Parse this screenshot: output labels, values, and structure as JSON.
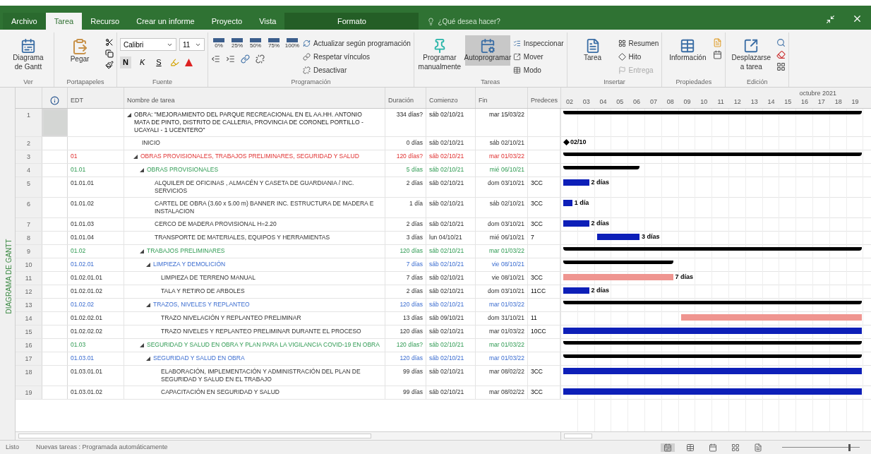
{
  "tabs": [
    {
      "label": "Archivo",
      "kind": "file",
      "selected": false
    },
    {
      "label": "Tarea",
      "kind": "normal",
      "selected": true
    },
    {
      "label": "Recurso",
      "kind": "normal",
      "selected": false
    },
    {
      "label": "Crear un informe",
      "kind": "normal",
      "selected": false
    },
    {
      "label": "Proyecto",
      "kind": "normal",
      "selected": false
    },
    {
      "label": "Vista",
      "kind": "normal",
      "selected": false
    },
    {
      "label": "Formato",
      "kind": "contextual",
      "selected": false
    }
  ],
  "search": {
    "placeholder": "¿Qué desea hacer?"
  },
  "ribbon": {
    "view": {
      "label": "Ver",
      "gantt": "Diagrama de Gantt"
    },
    "clipboard": {
      "label": "Portapapeles",
      "paste": "Pegar"
    },
    "font": {
      "label": "Fuente",
      "family": "Calibri",
      "size": "11",
      "styles": [
        "N",
        "K",
        "S"
      ]
    },
    "schedule": {
      "label": "Programación",
      "percents": [
        "0%",
        "25%",
        "50%",
        "75%",
        "100%"
      ],
      "actions": [
        {
          "label": "Actualizar según programación"
        },
        {
          "label": "Respetar vínculos"
        },
        {
          "label": "Desactivar"
        }
      ]
    },
    "tasks": {
      "label": "Tareas",
      "buttons": [
        {
          "label": "Programar manualmente",
          "selected": false
        },
        {
          "label": "Autoprogramar",
          "selected": true
        }
      ],
      "actions": [
        {
          "label": "Inspeccionar"
        },
        {
          "label": "Mover"
        },
        {
          "label": "Modo"
        }
      ]
    },
    "insert": {
      "label": "Insertar",
      "task": "Tarea",
      "actions": [
        {
          "label": "Resumen",
          "disabled": false
        },
        {
          "label": "Hito",
          "disabled": false
        },
        {
          "label": "Entrega",
          "disabled": true
        }
      ]
    },
    "properties": {
      "label": "Propiedades",
      "info": "Información"
    },
    "editing": {
      "label": "Edición",
      "scroll": "Desplazarse a tarea"
    }
  },
  "view_label": "DIAGRAMA DE GANTT",
  "columns": [
    "EDT",
    "Nombre de tarea",
    "Duración",
    "Comienzo",
    "Fin",
    "Predeces"
  ],
  "timeline": {
    "month": "octubre 2021",
    "days": [
      "02",
      "03",
      "04",
      "05",
      "06",
      "07",
      "08",
      "09",
      "10",
      "11",
      "12",
      "13",
      "14",
      "15",
      "16",
      "17",
      "18",
      "19"
    ]
  },
  "rows": [
    {
      "id": "1",
      "name": "OBRA: \"MEJORAMIENTO DEL PARQUE RECREACIONAL EN EL AA.HH. ANTONIO MATA DE PINTO, DISTRITO DE CALLERIA, PROVINCIA DE CORONEL PORTILLO - UCAYALI - 1 UCENTERO\"",
      "duration": "334 días?",
      "start": "sáb 02/10/21",
      "finish": "mar 15/03/22",
      "kind": "summary",
      "selected": true,
      "expanded": true,
      "children": [
        {
          "id": "2",
          "name": "INICIO",
          "duration": "0 días",
          "start": "sáb 02/10/21",
          "finish": "sáb 02/10/21",
          "kind": "milestone",
          "selected": false,
          "bar_label": "02/10"
        },
        {
          "id": "3",
          "code": "01",
          "name": "OBRAS PROVISIONALES, TRABAJOS PRELIMINARES, SEGURIDAD Y SALUD",
          "duration": "120 días?",
          "start": "sáb 02/10/21",
          "finish": "mar 01/03/22",
          "kind": "summary",
          "selected": false,
          "expanded": true,
          "children": [
            {
              "id": "4",
              "code": "01.01",
              "name": "OBRAS PROVISIONALES",
              "duration": "5 días",
              "start": "sáb 02/10/21",
              "finish": "mié 06/10/21",
              "kind": "summary",
              "selected": false,
              "expanded": true,
              "children": [
                {
                  "id": "5",
                  "code": "01.01.01",
                  "name": "ALQUILER DE OFICINAS , ALMACÉN Y CASETA DE GUARDIANIA / INC. SERVICIOS",
                  "duration": "2 días",
                  "start": "sáb 02/10/21",
                  "finish": "dom 03/10/21",
                  "pred": "3CC",
                  "kind": "task",
                  "critical": false,
                  "selected": false,
                  "bar_label": "2 días"
                },
                {
                  "id": "6",
                  "code": "01.01.02",
                  "name": "CARTEL DE OBRA (3.60 x 5.00 m) BANNER INC. ESTRUCTURA DE MADERA E INSTALACION",
                  "duration": "1 día",
                  "start": "sáb 02/10/21",
                  "finish": "sáb 02/10/21",
                  "pred": "3CC",
                  "kind": "task",
                  "critical": false,
                  "selected": false,
                  "bar_label": "1 día"
                },
                {
                  "id": "7",
                  "code": "01.01.03",
                  "name": "CERCO DE MADERA PROVISIONAL H=2.20",
                  "duration": "2 días",
                  "start": "sáb 02/10/21",
                  "finish": "dom 03/10/21",
                  "pred": "3CC",
                  "kind": "task",
                  "critical": false,
                  "selected": false,
                  "bar_label": "2 días"
                },
                {
                  "id": "8",
                  "code": "01.01.04",
                  "name": "TRANSPORTE DE MATERIALES, EQUIPOS Y HERRAMIENTAS",
                  "duration": "3 días",
                  "start": "lun 04/10/21",
                  "finish": "mié 06/10/21",
                  "pred": "7",
                  "kind": "task",
                  "critical": false,
                  "selected": false,
                  "bar_label": "3 días"
                }
              ]
            },
            {
              "id": "9",
              "code": "01.02",
              "name": "TRABAJOS PRELIMINARES",
              "duration": "120 días",
              "start": "sáb 02/10/21",
              "finish": "mar 01/03/22",
              "kind": "summary",
              "selected": false,
              "expanded": true,
              "children": [
                {
                  "id": "10",
                  "code": "01.02.01",
                  "name": "LIMPIEZA Y DEMOLICIÓN",
                  "duration": "7 días",
                  "start": "sáb 02/10/21",
                  "finish": "vie 08/10/21",
                  "kind": "summary",
                  "selected": false,
                  "expanded": true,
                  "children": [
                    {
                      "id": "11",
                      "code": "01.02.01.01",
                      "name": "LIMPIEZA DE TERRENO MANUAL",
                      "duration": "7 días",
                      "start": "sáb 02/10/21",
                      "finish": "vie 08/10/21",
                      "pred": "3CC",
                      "kind": "task",
                      "critical": true,
                      "selected": false,
                      "bar_label": "7 días"
                    },
                    {
                      "id": "12",
                      "code": "01.02.01.02",
                      "name": "TALA Y RETIRO DE ARBOLES",
                      "duration": "2 días",
                      "start": "sáb 02/10/21",
                      "finish": "dom 03/10/21",
                      "pred": "11CC",
                      "kind": "task",
                      "critical": false,
                      "selected": false,
                      "bar_label": "2 días"
                    }
                  ]
                },
                {
                  "id": "13",
                  "code": "01.02.02",
                  "name": "TRAZOS, NIVELES Y REPLANTEO",
                  "duration": "120 días",
                  "start": "sáb 02/10/21",
                  "finish": "mar 01/03/22",
                  "kind": "summary",
                  "selected": false,
                  "expanded": true,
                  "children": [
                    {
                      "id": "14",
                      "code": "01.02.02.01",
                      "name": "TRAZO NIVELACIÓN Y REPLANTEO PRELIMINAR",
                      "duration": "13 días",
                      "start": "sáb 09/10/21",
                      "finish": "dom 31/10/21",
                      "pred": "11",
                      "kind": "task",
                      "critical": true,
                      "selected": false
                    },
                    {
                      "id": "15",
                      "code": "01.02.02.02",
                      "name": "TRAZO NIVELES Y REPLANTEO PRELIMINAR DURANTE EL PROCESO",
                      "duration": "120 días",
                      "start": "sáb 02/10/21",
                      "finish": "mar 01/03/22",
                      "pred": "10CC",
                      "kind": "task",
                      "critical": false,
                      "selected": false
                    }
                  ]
                }
              ]
            },
            {
              "id": "16",
              "code": "01.03",
              "name": "SEGURIDAD Y SALUD EN OBRA Y PLAN PARA LA VIGILANCIA COVID-19 EN OBRA",
              "duration": "120 días?",
              "start": "sáb 02/10/21",
              "finish": "mar 01/03/22",
              "kind": "summary",
              "selected": false,
              "expanded": true,
              "children": [
                {
                  "id": "17",
                  "code": "01.03.01",
                  "name": "SEGURIDAD Y SALUD EN OBRA",
                  "duration": "120 días",
                  "start": "sáb 02/10/21",
                  "finish": "mar 01/03/22",
                  "kind": "summary",
                  "selected": false,
                  "expanded": true,
                  "children": [
                    {
                      "id": "18",
                      "code": "01.03.01.01",
                      "name": "ELABORACIÓN, IMPLEMENTACIÓN Y ADMINISTRACIÓN DEL PLAN DE SEGURIDAD Y SALUD EN EL TRABAJO",
                      "duration": "99 días",
                      "start": "sáb 02/10/21",
                      "finish": "mar 08/02/22",
                      "pred": "3CC",
                      "kind": "task",
                      "critical": false,
                      "selected": false
                    },
                    {
                      "id": "19",
                      "code": "01.03.01.02",
                      "name": "CAPACITACIÓN EN SEGURIDAD Y SALUD",
                      "duration": "99 días",
                      "start": "sáb 02/10/21",
                      "finish": "mar 08/02/22",
                      "pred": "3CC",
                      "kind": "task",
                      "critical": false,
                      "selected": false
                    }
                  ]
                }
              ]
            }
          ]
        }
      ]
    }
  ],
  "status": {
    "mode": "Listo",
    "new_tasks": "Nuevas tareas : Programada automáticamente"
  },
  "view_buttons": [
    {
      "selected": true
    },
    {
      "selected": false
    },
    {
      "selected": false
    },
    {
      "selected": false
    },
    {
      "selected": false
    }
  ],
  "zoom": {
    "level": 0.85
  }
}
